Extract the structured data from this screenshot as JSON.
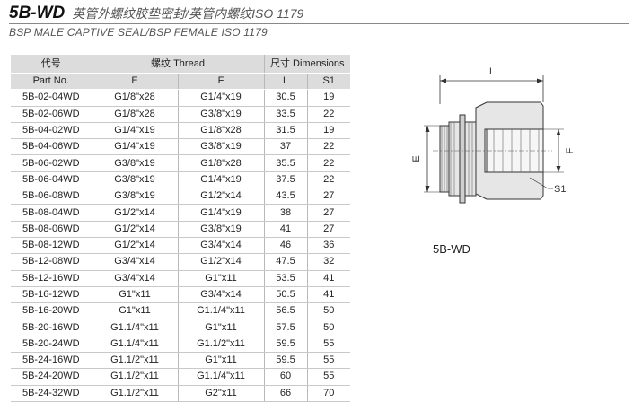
{
  "header": {
    "code": "5B-WD",
    "title_cn": "英管外螺纹胶垫密封/英管内螺纹ISO 1179",
    "subtitle": "BSP MALE CAPTIVE SEAL/BSP FEMALE ISO 1179"
  },
  "table": {
    "h_part_cn": "代号",
    "h_part_en": "Part No.",
    "h_thread": "螺纹  Thread",
    "h_dims": "尺寸 Dimensions",
    "h_e": "E",
    "h_f": "F",
    "h_l": "L",
    "h_s1": "S1",
    "rows": [
      [
        "5B-02-04WD",
        "G1/8\"x28",
        "G1/4\"x19",
        "30.5",
        "19"
      ],
      [
        "5B-02-06WD",
        "G1/8\"x28",
        "G3/8\"x19",
        "33.5",
        "22"
      ],
      [
        "5B-04-02WD",
        "G1/4\"x19",
        "G1/8\"x28",
        "31.5",
        "19"
      ],
      [
        "5B-04-06WD",
        "G1/4\"x19",
        "G3/8\"x19",
        "37",
        "22"
      ],
      [
        "5B-06-02WD",
        "G3/8\"x19",
        "G1/8\"x28",
        "35.5",
        "22"
      ],
      [
        "5B-06-04WD",
        "G3/8\"x19",
        "G1/4\"x19",
        "37.5",
        "22"
      ],
      [
        "5B-06-08WD",
        "G3/8\"x19",
        "G1/2\"x14",
        "43.5",
        "27"
      ],
      [
        "5B-08-04WD",
        "G1/2\"x14",
        "G1/4\"x19",
        "38",
        "27"
      ],
      [
        "5B-08-06WD",
        "G1/2\"x14",
        "G3/8\"x19",
        "41",
        "27"
      ],
      [
        "5B-08-12WD",
        "G1/2\"x14",
        "G3/4\"x14",
        "46",
        "36"
      ],
      [
        "5B-12-08WD",
        "G3/4\"x14",
        "G1/2\"x14",
        "47.5",
        "32"
      ],
      [
        "5B-12-16WD",
        "G3/4\"x14",
        "G1\"x11",
        "53.5",
        "41"
      ],
      [
        "5B-16-12WD",
        "G1\"x11",
        "G3/4\"x14",
        "50.5",
        "41"
      ],
      [
        "5B-16-20WD",
        "G1\"x11",
        "G1.1/4\"x11",
        "56.5",
        "50"
      ],
      [
        "5B-20-16WD",
        "G1.1/4\"x11",
        "G1\"x11",
        "57.5",
        "50"
      ],
      [
        "5B-20-24WD",
        "G1.1/4\"x11",
        "G1.1/2\"x11",
        "59.5",
        "55"
      ],
      [
        "5B-24-16WD",
        "G1.1/2\"x11",
        "G1\"x11",
        "59.5",
        "55"
      ],
      [
        "5B-24-20WD",
        "G1.1/2\"x11",
        "G1.1/4\"x11",
        "60",
        "55"
      ],
      [
        "5B-24-32WD",
        "G1.1/2\"x11",
        "G2\"x11",
        "66",
        "70"
      ]
    ]
  },
  "drawing": {
    "label_l": "L",
    "label_e": "E",
    "label_f": "F",
    "label_s1": "S1",
    "model": "5B-WD"
  }
}
